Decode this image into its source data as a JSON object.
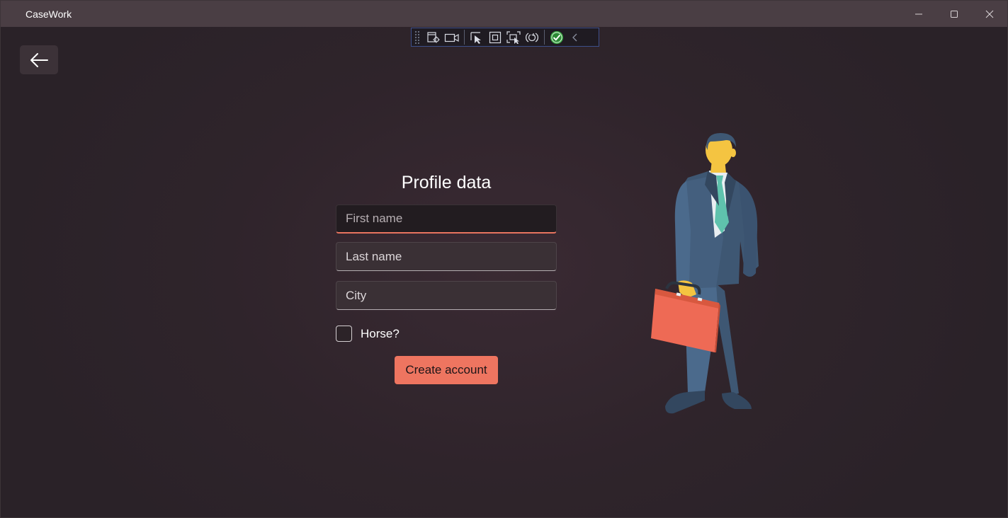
{
  "window": {
    "title": "CaseWork",
    "controls": [
      "minimize-icon",
      "maximize-icon",
      "close-icon"
    ]
  },
  "debug_toolbar": {
    "tools": [
      "live-visual-tree-icon",
      "record-icon",
      "select-element-icon",
      "display-layout-adorners-icon",
      "track-focus-icon",
      "hot-reload-icon",
      "binding-status-icon",
      "collapse-chevron-icon"
    ]
  },
  "nav": {
    "back_icon": "back-arrow-icon"
  },
  "form": {
    "title": "Profile data",
    "first_name": {
      "placeholder": "First name",
      "value": ""
    },
    "last_name": {
      "placeholder": "Last name",
      "value": ""
    },
    "city": {
      "placeholder": "City",
      "value": ""
    },
    "horse_checkbox": {
      "label": "Horse?",
      "checked": false
    },
    "submit_label": "Create account"
  },
  "illustration": {
    "icon": "businessman-with-briefcase-illustration"
  },
  "colors": {
    "accent": "#ee7560",
    "background": "#2f242b",
    "titlebar": "#4a3e44",
    "field_bg": "#3a3035"
  }
}
